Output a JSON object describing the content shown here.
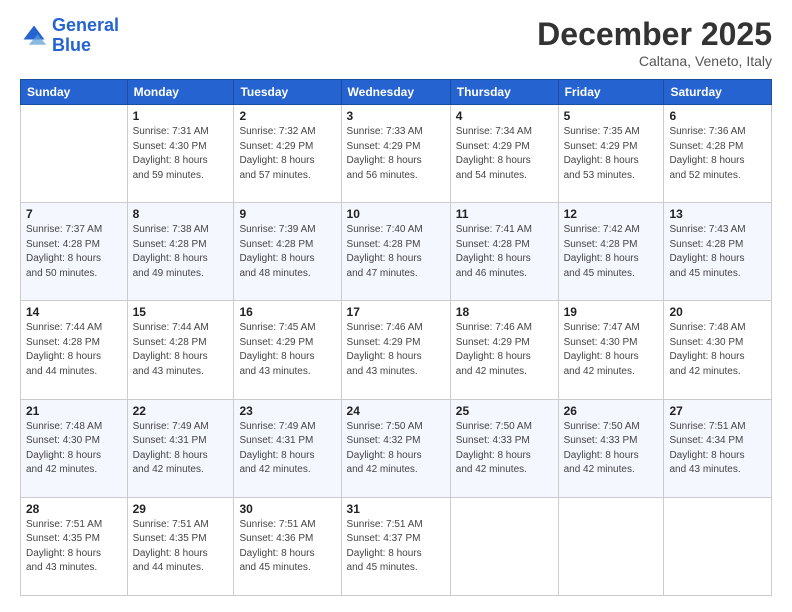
{
  "header": {
    "logo_line1": "General",
    "logo_line2": "Blue",
    "month": "December 2025",
    "location": "Caltana, Veneto, Italy"
  },
  "weekdays": [
    "Sunday",
    "Monday",
    "Tuesday",
    "Wednesday",
    "Thursday",
    "Friday",
    "Saturday"
  ],
  "weeks": [
    [
      {
        "day": "",
        "info": ""
      },
      {
        "day": "1",
        "info": "Sunrise: 7:31 AM\nSunset: 4:30 PM\nDaylight: 8 hours\nand 59 minutes."
      },
      {
        "day": "2",
        "info": "Sunrise: 7:32 AM\nSunset: 4:29 PM\nDaylight: 8 hours\nand 57 minutes."
      },
      {
        "day": "3",
        "info": "Sunrise: 7:33 AM\nSunset: 4:29 PM\nDaylight: 8 hours\nand 56 minutes."
      },
      {
        "day": "4",
        "info": "Sunrise: 7:34 AM\nSunset: 4:29 PM\nDaylight: 8 hours\nand 54 minutes."
      },
      {
        "day": "5",
        "info": "Sunrise: 7:35 AM\nSunset: 4:29 PM\nDaylight: 8 hours\nand 53 minutes."
      },
      {
        "day": "6",
        "info": "Sunrise: 7:36 AM\nSunset: 4:28 PM\nDaylight: 8 hours\nand 52 minutes."
      }
    ],
    [
      {
        "day": "7",
        "info": "Sunrise: 7:37 AM\nSunset: 4:28 PM\nDaylight: 8 hours\nand 50 minutes."
      },
      {
        "day": "8",
        "info": "Sunrise: 7:38 AM\nSunset: 4:28 PM\nDaylight: 8 hours\nand 49 minutes."
      },
      {
        "day": "9",
        "info": "Sunrise: 7:39 AM\nSunset: 4:28 PM\nDaylight: 8 hours\nand 48 minutes."
      },
      {
        "day": "10",
        "info": "Sunrise: 7:40 AM\nSunset: 4:28 PM\nDaylight: 8 hours\nand 47 minutes."
      },
      {
        "day": "11",
        "info": "Sunrise: 7:41 AM\nSunset: 4:28 PM\nDaylight: 8 hours\nand 46 minutes."
      },
      {
        "day": "12",
        "info": "Sunrise: 7:42 AM\nSunset: 4:28 PM\nDaylight: 8 hours\nand 45 minutes."
      },
      {
        "day": "13",
        "info": "Sunrise: 7:43 AM\nSunset: 4:28 PM\nDaylight: 8 hours\nand 45 minutes."
      }
    ],
    [
      {
        "day": "14",
        "info": "Sunrise: 7:44 AM\nSunset: 4:28 PM\nDaylight: 8 hours\nand 44 minutes."
      },
      {
        "day": "15",
        "info": "Sunrise: 7:44 AM\nSunset: 4:28 PM\nDaylight: 8 hours\nand 43 minutes."
      },
      {
        "day": "16",
        "info": "Sunrise: 7:45 AM\nSunset: 4:29 PM\nDaylight: 8 hours\nand 43 minutes."
      },
      {
        "day": "17",
        "info": "Sunrise: 7:46 AM\nSunset: 4:29 PM\nDaylight: 8 hours\nand 43 minutes."
      },
      {
        "day": "18",
        "info": "Sunrise: 7:46 AM\nSunset: 4:29 PM\nDaylight: 8 hours\nand 42 minutes."
      },
      {
        "day": "19",
        "info": "Sunrise: 7:47 AM\nSunset: 4:30 PM\nDaylight: 8 hours\nand 42 minutes."
      },
      {
        "day": "20",
        "info": "Sunrise: 7:48 AM\nSunset: 4:30 PM\nDaylight: 8 hours\nand 42 minutes."
      }
    ],
    [
      {
        "day": "21",
        "info": "Sunrise: 7:48 AM\nSunset: 4:30 PM\nDaylight: 8 hours\nand 42 minutes."
      },
      {
        "day": "22",
        "info": "Sunrise: 7:49 AM\nSunset: 4:31 PM\nDaylight: 8 hours\nand 42 minutes."
      },
      {
        "day": "23",
        "info": "Sunrise: 7:49 AM\nSunset: 4:31 PM\nDaylight: 8 hours\nand 42 minutes."
      },
      {
        "day": "24",
        "info": "Sunrise: 7:50 AM\nSunset: 4:32 PM\nDaylight: 8 hours\nand 42 minutes."
      },
      {
        "day": "25",
        "info": "Sunrise: 7:50 AM\nSunset: 4:33 PM\nDaylight: 8 hours\nand 42 minutes."
      },
      {
        "day": "26",
        "info": "Sunrise: 7:50 AM\nSunset: 4:33 PM\nDaylight: 8 hours\nand 42 minutes."
      },
      {
        "day": "27",
        "info": "Sunrise: 7:51 AM\nSunset: 4:34 PM\nDaylight: 8 hours\nand 43 minutes."
      }
    ],
    [
      {
        "day": "28",
        "info": "Sunrise: 7:51 AM\nSunset: 4:35 PM\nDaylight: 8 hours\nand 43 minutes."
      },
      {
        "day": "29",
        "info": "Sunrise: 7:51 AM\nSunset: 4:35 PM\nDaylight: 8 hours\nand 44 minutes."
      },
      {
        "day": "30",
        "info": "Sunrise: 7:51 AM\nSunset: 4:36 PM\nDaylight: 8 hours\nand 45 minutes."
      },
      {
        "day": "31",
        "info": "Sunrise: 7:51 AM\nSunset: 4:37 PM\nDaylight: 8 hours\nand 45 minutes."
      },
      {
        "day": "",
        "info": ""
      },
      {
        "day": "",
        "info": ""
      },
      {
        "day": "",
        "info": ""
      }
    ]
  ]
}
